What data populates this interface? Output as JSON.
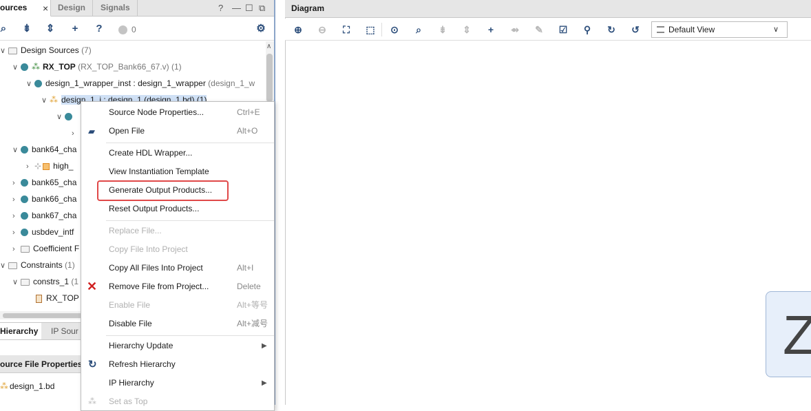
{
  "left_panel": {
    "tabs": [
      "ources",
      "Design",
      "Signals"
    ],
    "window_buttons": [
      "?",
      "—",
      "☐",
      "⧉"
    ],
    "toolbar": {
      "status_count": "0"
    },
    "tree": {
      "design_sources": {
        "label": "Design Sources",
        "count": "(7)"
      },
      "rx_top": {
        "label": "RX_TOP",
        "detail": "(RX_TOP_Bank66_67.v) (1)"
      },
      "wrapper_inst": {
        "label": "design_1_wrapper_inst : design_1_wrapper",
        "detail": "(design_1_w"
      },
      "design_1_i": {
        "label": "design_1_i : design_1 (design_1.bd) (1)"
      },
      "bank64": {
        "label": "bank64_cha"
      },
      "high": {
        "label": "high_"
      },
      "bank65": {
        "label": "bank65_cha"
      },
      "bank66": {
        "label": "bank66_cha"
      },
      "bank67": {
        "label": "bank67_cha"
      },
      "usbdev": {
        "label": "usbdev_intf"
      },
      "coefficient": {
        "label": "Coefficient F"
      },
      "constraints": {
        "label": "Constraints",
        "count": "(1)"
      },
      "constrs_1": {
        "label": "constrs_1",
        "count": "(1"
      },
      "rx_top_xdc": {
        "label": "RX_TOP"
      }
    },
    "bottom_tabs": [
      "Hierarchy",
      "IP Sour"
    ],
    "source_file_properties": {
      "title": "ource File Properties",
      "file": "design_1.bd"
    }
  },
  "diagram_panel": {
    "title": "Diagram",
    "view_select": "Default View",
    "card_letter": "Z"
  },
  "context_menu": {
    "items": [
      {
        "label": "Source Node Properties...",
        "shortcut": "Ctrl+E",
        "disabled": false
      },
      {
        "label": "Open File",
        "shortcut": "Alt+O",
        "disabled": false
      },
      {
        "label": "Create HDL Wrapper...",
        "shortcut": "",
        "disabled": false
      },
      {
        "label": "View Instantiation Template",
        "shortcut": "",
        "disabled": false
      },
      {
        "label": "Generate Output Products...",
        "shortcut": "",
        "disabled": false
      },
      {
        "label": "Reset Output Products...",
        "shortcut": "",
        "disabled": false
      },
      {
        "label": "Replace File...",
        "shortcut": "",
        "disabled": true
      },
      {
        "label": "Copy File Into Project",
        "shortcut": "",
        "disabled": true
      },
      {
        "label": "Copy All Files Into Project",
        "shortcut": "Alt+I",
        "disabled": false
      },
      {
        "label": "Remove File from Project...",
        "shortcut": "Delete",
        "disabled": false
      },
      {
        "label": "Enable File",
        "shortcut": "Alt+等号",
        "disabled": true
      },
      {
        "label": "Disable File",
        "shortcut": "Alt+减号",
        "disabled": false
      },
      {
        "label": "Hierarchy Update",
        "shortcut": "",
        "disabled": false
      },
      {
        "label": "Refresh Hierarchy",
        "shortcut": "",
        "disabled": false
      },
      {
        "label": "IP Hierarchy",
        "shortcut": "",
        "disabled": false
      },
      {
        "label": "Set as Top",
        "shortcut": "",
        "disabled": true
      }
    ]
  },
  "colors": {
    "accent": "#2b4d7a",
    "highlight": "#e04848",
    "selection": "#cfe0f5"
  }
}
